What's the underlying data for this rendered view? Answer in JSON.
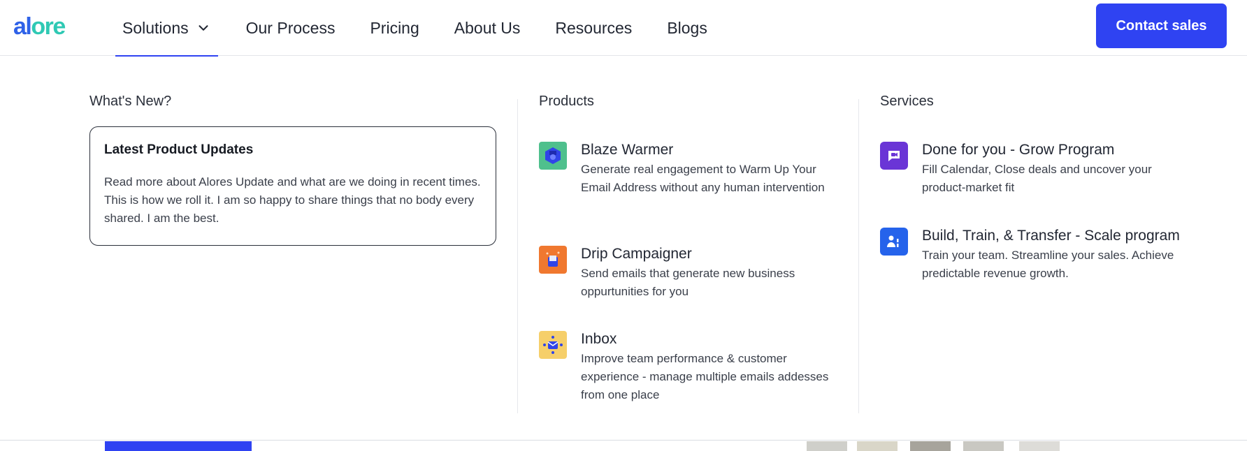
{
  "header": {
    "logo": {
      "part1": "al",
      "part2": "ore"
    },
    "nav": [
      {
        "label": "Solutions"
      },
      {
        "label": "Our Process"
      },
      {
        "label": "Pricing"
      },
      {
        "label": "About Us"
      },
      {
        "label": "Resources"
      },
      {
        "label": "Blogs"
      }
    ],
    "contact_label": "Contact sales"
  },
  "menu": {
    "whats_new": {
      "title": "What's New?",
      "card_title": "Latest Product Updates",
      "card_text": "Read more about Alores Update and what are we doing in recent times. This is how we roll it. I am so happy to share things that no body every shared. I am the best."
    },
    "products": {
      "title": "Products",
      "items": [
        {
          "title": "Blaze Warmer",
          "desc": "Generate real engagement to Warm Up Your Email Address without any human intervention",
          "icon": "blaze-warmer-icon"
        },
        {
          "title": "Drip Campaigner",
          "desc": "Send emails that generate new business oppurtunities for you",
          "icon": "drip-campaigner-icon"
        },
        {
          "title": "Inbox",
          "desc": "Improve team performance & customer experience - manage multiple emails addesses from one place",
          "icon": "inbox-icon"
        }
      ]
    },
    "services": {
      "title": "Services",
      "items": [
        {
          "title": "Done for you - Grow Program",
          "desc": "Fill Calendar, Close deals and uncover your product-market fit",
          "icon": "chat-icon"
        },
        {
          "title": "Build, Train, & Transfer - Scale program",
          "desc": "Train your team. Streamline your sales. Achieve predictable revenue growth.",
          "icon": "team-icon"
        }
      ]
    }
  },
  "colors": {
    "accent": "#2f43f2",
    "logo_blue": "#2f62e8",
    "logo_teal": "#2fc9b4",
    "purple": "#6a35d6",
    "service_blue": "#2563eb"
  }
}
